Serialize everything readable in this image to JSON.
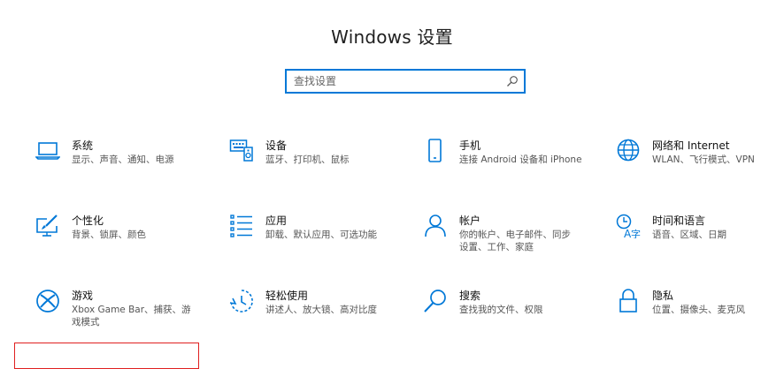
{
  "window": {
    "title": "Windows 设置"
  },
  "search": {
    "placeholder": "查找设置",
    "value": ""
  },
  "accent": "#0078d7",
  "tiles": [
    {
      "name": "系统",
      "desc": "显示、声音、通知、电源",
      "icon": "laptop-icon"
    },
    {
      "name": "设备",
      "desc": "蓝牙、打印机、鼠标",
      "icon": "keyboard-devices-icon"
    },
    {
      "name": "手机",
      "desc": "连接 Android 设备和 iPhone",
      "icon": "phone-icon"
    },
    {
      "name": "网络和 Internet",
      "desc": "WLAN、飞行模式、VPN",
      "icon": "globe-icon"
    },
    {
      "name": "个性化",
      "desc": "背景、锁屏、颜色",
      "icon": "paintbrush-monitor-icon"
    },
    {
      "name": "应用",
      "desc": "卸载、默认应用、可选功能",
      "icon": "apps-list-icon"
    },
    {
      "name": "帐户",
      "desc": "你的帐户、电子邮件、同步设置、工作、家庭",
      "icon": "person-icon"
    },
    {
      "name": "时间和语言",
      "desc": "语音、区域、日期",
      "icon": "time-language-icon"
    },
    {
      "name": "游戏",
      "desc": "Xbox Game Bar、捕获、游戏模式",
      "icon": "xbox-icon"
    },
    {
      "name": "轻松使用",
      "desc": "讲述人、放大镜、高对比度",
      "icon": "ease-of-access-icon"
    },
    {
      "name": "搜索",
      "desc": "查找我的文件、权限",
      "icon": "magnifier-icon"
    },
    {
      "name": "隐私",
      "desc": "位置、摄像头、麦克风",
      "icon": "lock-icon"
    }
  ]
}
